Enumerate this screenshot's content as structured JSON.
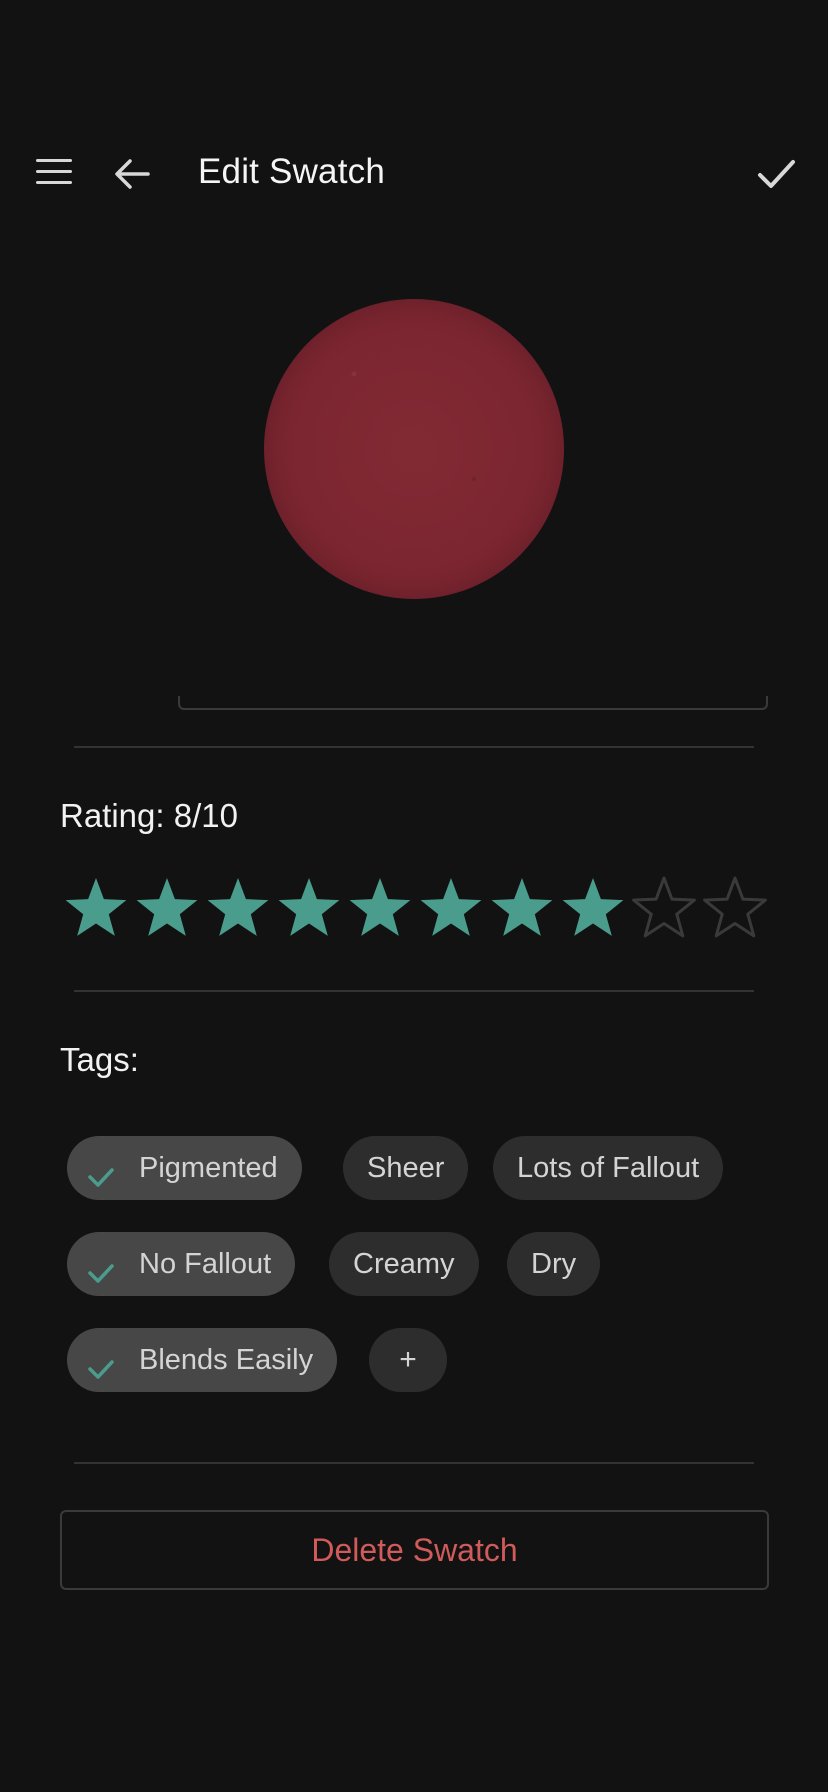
{
  "header": {
    "title": "Edit Swatch",
    "menu_icon": "hamburger-menu-icon",
    "back_icon": "arrow-left-icon",
    "save_icon": "checkmark-icon"
  },
  "swatch": {
    "color": "#7f2832"
  },
  "rating": {
    "label": "Rating: 8/10",
    "value": 8,
    "max": 10,
    "filled_color": "#4a9c8c",
    "empty_color": "#3a3a3a"
  },
  "tags": {
    "label": "Tags:",
    "items": [
      {
        "label": "Pigmented",
        "selected": true
      },
      {
        "label": "Sheer",
        "selected": false
      },
      {
        "label": "Lots of Fallout",
        "selected": false
      },
      {
        "label": "No Fallout",
        "selected": true
      },
      {
        "label": "Creamy",
        "selected": false
      },
      {
        "label": "Dry",
        "selected": false
      },
      {
        "label": "Blends Easily",
        "selected": true
      }
    ],
    "add_label": "+",
    "check_color": "#4a9c8c"
  },
  "delete_button": {
    "label": "Delete Swatch",
    "color": "#d15a5a"
  }
}
